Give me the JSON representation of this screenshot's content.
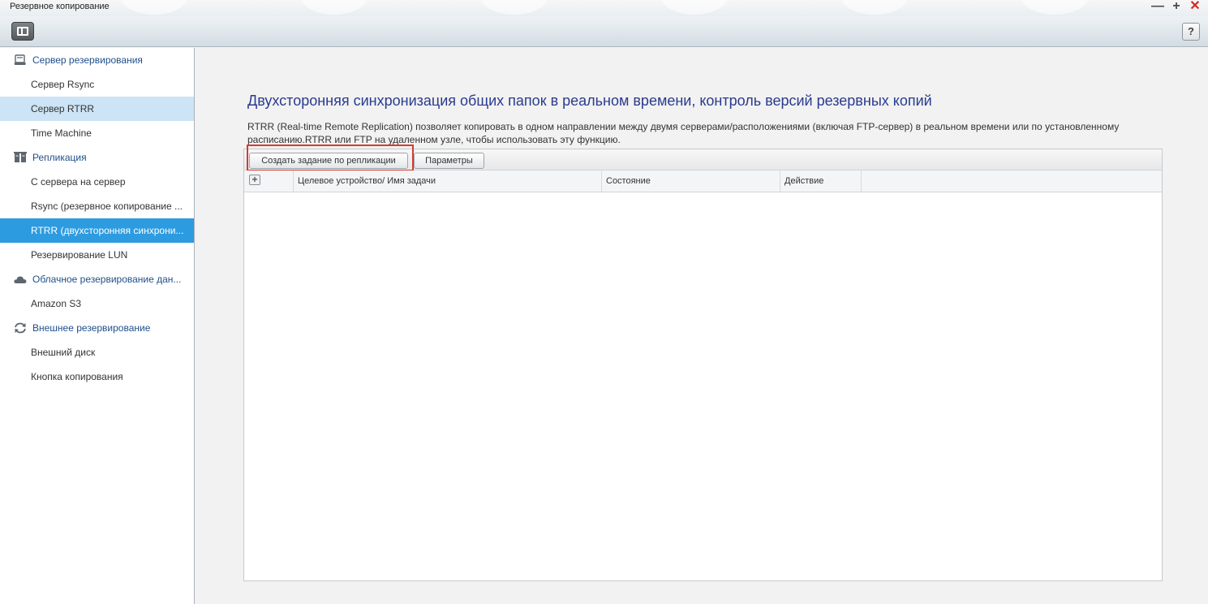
{
  "window": {
    "title": "Резервное копирование",
    "controls": {
      "minimize": "—",
      "maximize": "+",
      "close": "✕"
    }
  },
  "toolbar": {
    "help_label": "?"
  },
  "sidebar": {
    "items": [
      {
        "label": "Сервер резервирования",
        "kind": "category",
        "icon": "server-backup-icon"
      },
      {
        "label": "Сервер Rsync",
        "kind": "item"
      },
      {
        "label": "Сервер RTRR",
        "kind": "item",
        "state": "highlighted"
      },
      {
        "label": "Time Machine",
        "kind": "item"
      },
      {
        "label": "Репликация",
        "kind": "category",
        "icon": "replication-icon"
      },
      {
        "label": "С сервера на сервер",
        "kind": "item"
      },
      {
        "label": "Rsync (резервное копирование ...",
        "kind": "item"
      },
      {
        "label": "RTRR (двухсторонняя синхрони...",
        "kind": "item",
        "state": "selected"
      },
      {
        "label": "Резервирование LUN",
        "kind": "item"
      },
      {
        "label": "Облачное резервирование дан...",
        "kind": "category",
        "icon": "cloud-icon"
      },
      {
        "label": "Amazon S3",
        "kind": "item"
      },
      {
        "label": "Внешнее резервирование",
        "kind": "category",
        "icon": "sync-arrows-icon"
      },
      {
        "label": "Внешний диск",
        "kind": "item"
      },
      {
        "label": "Кнопка копирования",
        "kind": "item"
      }
    ]
  },
  "main": {
    "heading": "Двухсторонняя синхронизация общих папок в реальном времени, контроль версий резервных копий",
    "description": "RTRR (Real-time Remote Replication) позволяет копировать в одном направлении между двумя серверами/расположениями (включая FTP-сервер) в реальном времени или по установленному расписанию.RTRR или FTP на удаленном узле, чтобы использовать эту функцию.",
    "buttons": {
      "create_job": "Создать задание по репликации",
      "parameters": "Параметры"
    },
    "table": {
      "expand_symbol": "+",
      "columns": [
        "Целевое устройство/ Имя задачи",
        "Состояние",
        "Действие"
      ]
    }
  },
  "colors": {
    "accent": "#2d9be0",
    "heading": "#2a3b8f",
    "highlight_frame": "#d63b33",
    "selected_light": "#cce4f5"
  }
}
